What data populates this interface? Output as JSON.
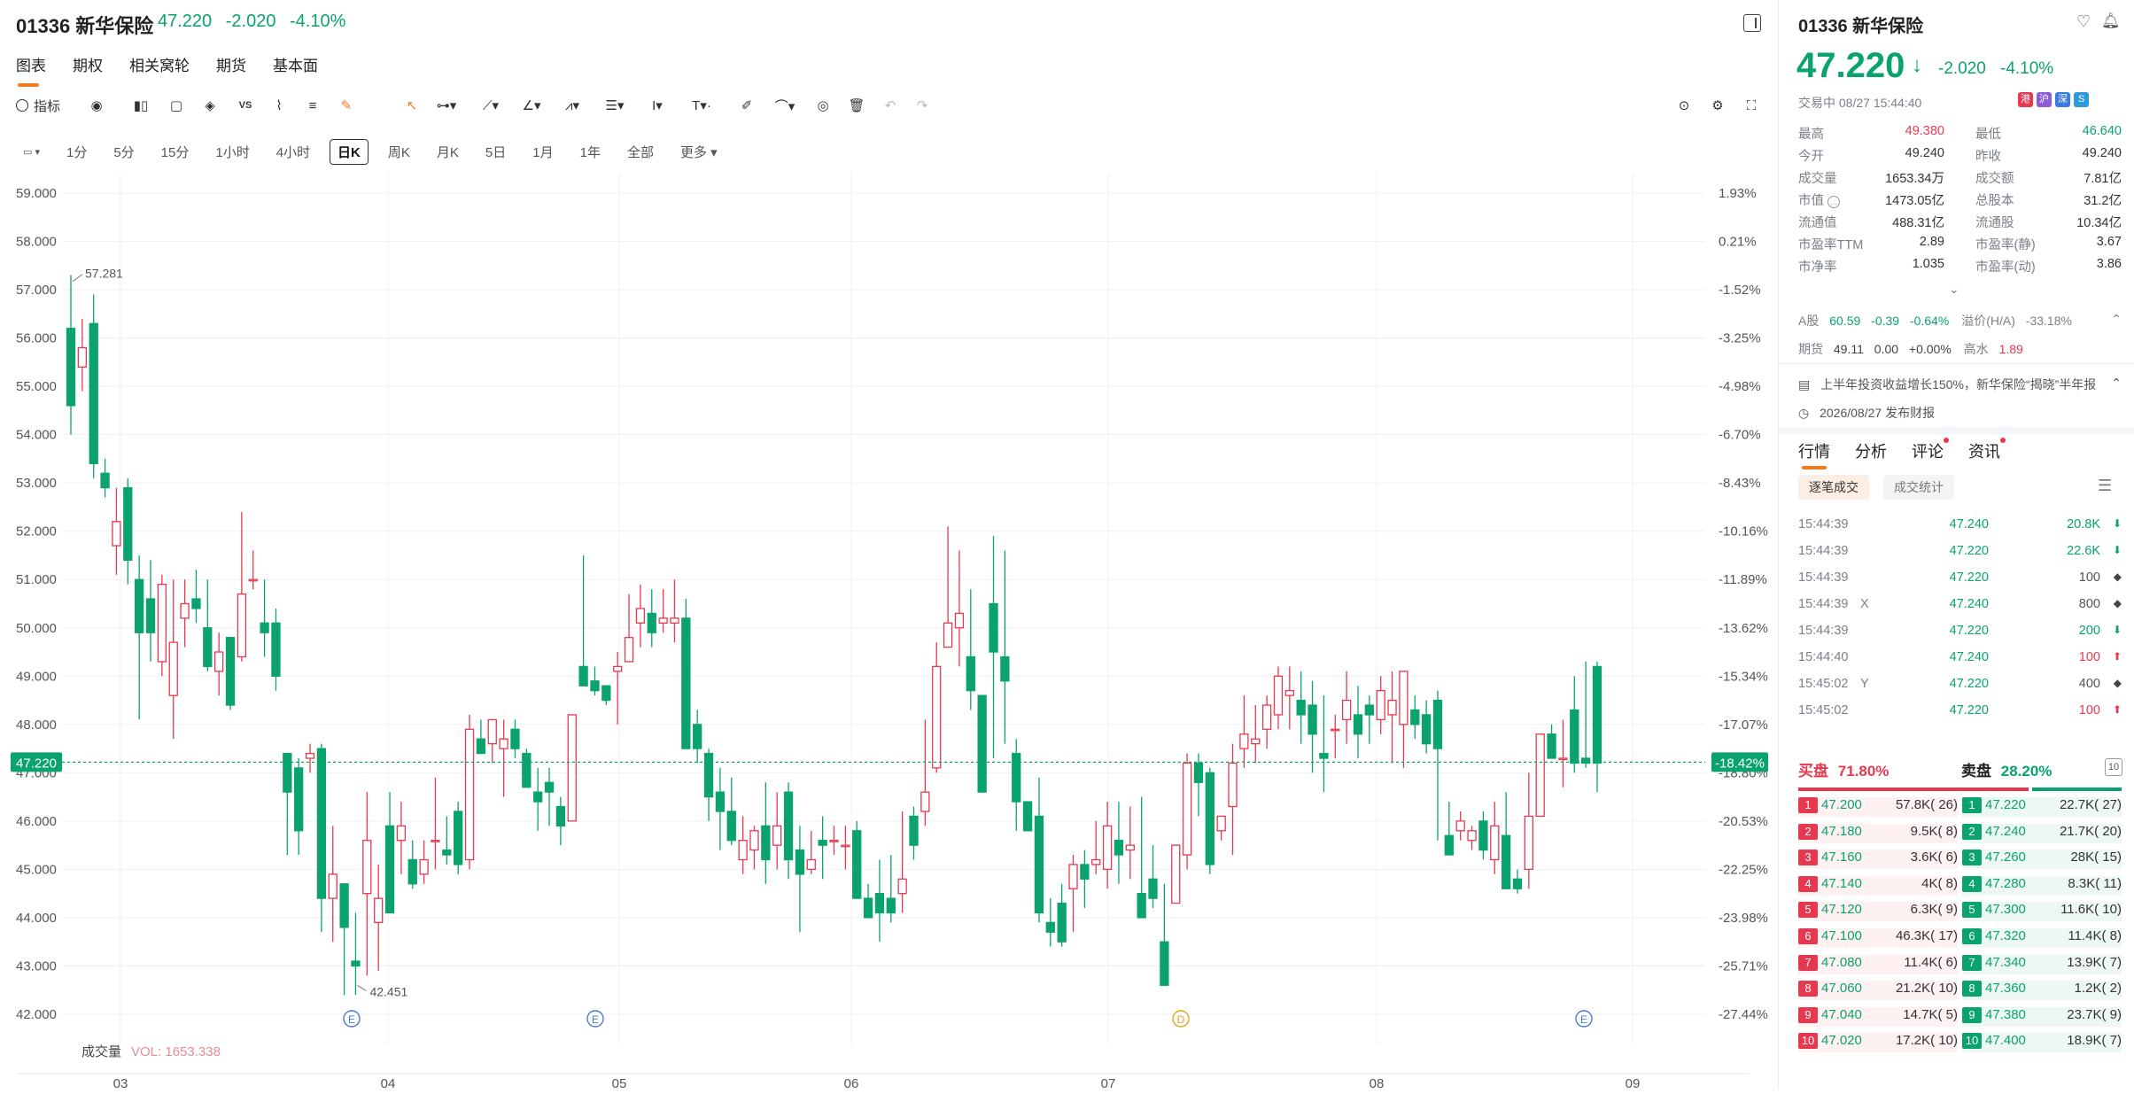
{
  "header": {
    "symbol": "01336 新华保险",
    "price": "47.220",
    "change": "-2.020",
    "change_pct": "-4.10%",
    "tabs": [
      "图表",
      "期权",
      "相关窝轮",
      "期货",
      "基本面"
    ],
    "active_tab": 0
  },
  "toolbar": {
    "indicator_label": "指标",
    "icons": [
      "indicator-icon",
      "replay-icon",
      "candle-type-icon",
      "square-icon",
      "layers-icon",
      "vs-icon",
      "chart-type-icon",
      "text-lines-icon",
      "pen-icon",
      "cursor-icon",
      "line-tool-icon",
      "trend-tool-icon",
      "angle-tool-icon",
      "pattern-tool-icon",
      "fib-tool-icon",
      "measure-tool-icon",
      "text-tool-icon",
      "brush-tool-icon",
      "eye-icon",
      "trash-icon",
      "undo-icon",
      "redo-icon"
    ],
    "right_icons": [
      "camera-icon",
      "settings-icon",
      "fullscreen-icon"
    ]
  },
  "periods": {
    "items": [
      "1分",
      "5分",
      "15分",
      "1小时",
      "4小时",
      "日K",
      "周K",
      "月K",
      "5日",
      "1月",
      "1年",
      "全部",
      "更多"
    ],
    "active": "日K"
  },
  "chart_data": {
    "type": "candlestick",
    "y_ticks": [
      "59.000",
      "58.000",
      "57.000",
      "56.000",
      "55.000",
      "54.000",
      "53.000",
      "52.000",
      "51.000",
      "50.000",
      "49.000",
      "48.000",
      "47.000",
      "46.000",
      "45.000",
      "44.000",
      "43.000",
      "42.000"
    ],
    "pct_ticks": [
      "1.93%",
      "0.21%",
      "-1.52%",
      "-3.25%",
      "-4.98%",
      "-6.70%",
      "-8.43%",
      "-10.16%",
      "-11.89%",
      "-13.62%",
      "-15.34%",
      "-17.07%",
      "-18.80%",
      "-20.53%",
      "-22.25%",
      "-23.98%",
      "-25.71%",
      "-27.44%"
    ],
    "x_labels": [
      "03",
      "04",
      "05",
      "06",
      "07",
      "08",
      "09"
    ],
    "ylim": [
      42.0,
      59.0
    ],
    "last_price": "47.220",
    "last_pct": "-18.42%",
    "high_label": "57.281",
    "low_label": "42.451",
    "event_markers": [
      "E",
      "E",
      "D",
      "E"
    ],
    "volume_label": "成交量",
    "volume_value": "VOL: 1653.338",
    "candles": [
      [
        56.2,
        57.3,
        54.0,
        54.6
      ],
      [
        55.4,
        56.4,
        54.9,
        55.8
      ],
      [
        56.3,
        56.9,
        53.1,
        53.4
      ],
      [
        53.2,
        53.5,
        52.7,
        52.9
      ],
      [
        51.7,
        52.9,
        51.1,
        52.2
      ],
      [
        52.9,
        53.1,
        50.9,
        51.4
      ],
      [
        51.0,
        51.5,
        48.1,
        49.9
      ],
      [
        50.6,
        51.4,
        49.3,
        49.9
      ],
      [
        49.3,
        51.1,
        49.0,
        50.9
      ],
      [
        48.6,
        51.0,
        47.7,
        49.7
      ],
      [
        50.2,
        51.0,
        49.6,
        50.5
      ],
      [
        50.6,
        51.2,
        50.1,
        50.4
      ],
      [
        50.0,
        51.0,
        49.1,
        49.2
      ],
      [
        49.1,
        49.9,
        48.6,
        49.5
      ],
      [
        49.8,
        49.4,
        48.3,
        48.4
      ],
      [
        49.4,
        52.4,
        49.3,
        50.7
      ],
      [
        51.0,
        51.6,
        50.8,
        51.0
      ],
      [
        50.1,
        51.0,
        49.4,
        49.9
      ],
      [
        50.1,
        50.4,
        48.7,
        49.0
      ],
      [
        47.4,
        47.4,
        45.3,
        46.6
      ],
      [
        47.1,
        47.3,
        45.3,
        45.8
      ],
      [
        47.3,
        47.6,
        47.0,
        47.4
      ],
      [
        47.5,
        47.6,
        43.7,
        44.4
      ],
      [
        44.4,
        45.9,
        43.5,
        44.9
      ],
      [
        44.7,
        44.6,
        42.4,
        43.8
      ],
      [
        43.1,
        44.1,
        42.4,
        43.0
      ],
      [
        44.5,
        46.6,
        42.8,
        45.6
      ],
      [
        43.9,
        45.1,
        42.9,
        44.4
      ],
      [
        45.9,
        46.6,
        44.5,
        44.1
      ],
      [
        45.6,
        46.4,
        44.9,
        45.9
      ],
      [
        45.2,
        45.6,
        44.6,
        44.7
      ],
      [
        44.9,
        45.6,
        44.7,
        45.2
      ],
      [
        45.6,
        46.9,
        45.0,
        45.6
      ],
      [
        45.4,
        46.1,
        45.1,
        45.3
      ],
      [
        46.2,
        46.4,
        44.9,
        45.1
      ],
      [
        45.2,
        48.2,
        45.0,
        47.9
      ],
      [
        47.7,
        48.1,
        47.6,
        47.4
      ],
      [
        47.6,
        48.1,
        47.2,
        48.1
      ],
      [
        47.5,
        48.1,
        46.5,
        47.7
      ],
      [
        47.9,
        48.1,
        47.3,
        47.5
      ],
      [
        47.4,
        47.5,
        46.7,
        46.7
      ],
      [
        46.6,
        47.1,
        45.8,
        46.4
      ],
      [
        46.8,
        47.1,
        45.9,
        46.6
      ],
      [
        46.3,
        46.5,
        45.5,
        45.9
      ],
      [
        46.0,
        48.1,
        46.0,
        48.2
      ],
      [
        49.2,
        51.5,
        49.0,
        48.8
      ],
      [
        48.9,
        49.2,
        48.6,
        48.7
      ],
      [
        48.8,
        48.6,
        48.4,
        48.5
      ],
      [
        49.1,
        49.5,
        48.0,
        49.2
      ],
      [
        49.3,
        50.7,
        49.3,
        49.8
      ],
      [
        50.1,
        50.9,
        49.6,
        50.4
      ],
      [
        50.3,
        50.8,
        49.6,
        49.9
      ],
      [
        50.1,
        50.8,
        49.9,
        50.2
      ],
      [
        50.1,
        51.0,
        49.7,
        50.2
      ],
      [
        50.2,
        50.6,
        47.8,
        47.5
      ],
      [
        48.0,
        48.3,
        47.2,
        47.5
      ],
      [
        47.4,
        47.5,
        46.0,
        46.5
      ],
      [
        46.6,
        47.1,
        45.4,
        46.2
      ],
      [
        46.2,
        46.9,
        45.5,
        45.6
      ],
      [
        45.2,
        46.1,
        44.9,
        45.6
      ],
      [
        45.4,
        45.9,
        45.0,
        45.8
      ],
      [
        45.9,
        46.8,
        44.7,
        45.2
      ],
      [
        45.5,
        46.6,
        45.0,
        45.9
      ],
      [
        46.6,
        46.8,
        44.8,
        45.2
      ],
      [
        45.4,
        45.9,
        43.7,
        44.9
      ],
      [
        45.0,
        45.8,
        44.9,
        45.2
      ],
      [
        45.6,
        46.1,
        44.8,
        45.5
      ],
      [
        45.6,
        45.9,
        45.3,
        45.6
      ],
      [
        45.5,
        45.9,
        45.0,
        45.5
      ],
      [
        45.8,
        46.0,
        44.4,
        44.4
      ],
      [
        44.4,
        44.7,
        44.1,
        44.0
      ],
      [
        44.5,
        45.2,
        43.5,
        44.1
      ],
      [
        44.4,
        45.3,
        43.9,
        44.1
      ],
      [
        44.5,
        46.2,
        44.1,
        44.8
      ],
      [
        46.1,
        46.3,
        45.2,
        45.5
      ],
      [
        46.2,
        48.1,
        45.9,
        46.6
      ],
      [
        47.1,
        49.7,
        47.0,
        49.2
      ],
      [
        49.6,
        52.1,
        49.6,
        50.1
      ],
      [
        50.0,
        51.6,
        49.2,
        50.3
      ],
      [
        49.4,
        50.8,
        48.3,
        48.7
      ],
      [
        48.6,
        48.5,
        46.7,
        46.6
      ],
      [
        50.5,
        51.9,
        47.3,
        49.5
      ],
      [
        49.4,
        51.6,
        47.6,
        48.9
      ],
      [
        47.4,
        47.7,
        45.8,
        46.4
      ],
      [
        46.4,
        46.4,
        45.8,
        45.8
      ],
      [
        46.1,
        46.9,
        43.9,
        44.1
      ],
      [
        43.9,
        44.4,
        43.4,
        43.7
      ],
      [
        44.3,
        44.7,
        43.4,
        43.5
      ],
      [
        44.6,
        45.3,
        43.7,
        45.1
      ],
      [
        45.1,
        45.4,
        44.2,
        44.8
      ],
      [
        45.1,
        46.0,
        44.9,
        45.2
      ],
      [
        45.0,
        46.4,
        44.6,
        45.9
      ],
      [
        45.6,
        46.4,
        44.7,
        45.3
      ],
      [
        45.4,
        46.3,
        44.8,
        45.5
      ],
      [
        44.5,
        46.5,
        44.2,
        44.0
      ],
      [
        44.8,
        45.5,
        44.2,
        44.4
      ],
      [
        43.5,
        44.7,
        42.9,
        42.6
      ],
      [
        44.3,
        45.5,
        44.3,
        45.5
      ],
      [
        45.3,
        47.4,
        45.0,
        47.2
      ],
      [
        47.2,
        47.4,
        46.1,
        46.8
      ],
      [
        47.0,
        47.1,
        44.9,
        45.1
      ],
      [
        45.8,
        46.1,
        45.6,
        46.1
      ],
      [
        46.3,
        47.6,
        45.3,
        47.2
      ],
      [
        47.5,
        48.6,
        47.1,
        47.8
      ],
      [
        47.6,
        48.4,
        47.2,
        47.7
      ],
      [
        47.9,
        48.6,
        47.5,
        48.4
      ],
      [
        48.2,
        49.2,
        47.9,
        49.0
      ],
      [
        48.6,
        49.2,
        47.9,
        48.7
      ],
      [
        48.5,
        49.1,
        47.6,
        48.2
      ],
      [
        48.4,
        48.9,
        47.0,
        47.8
      ],
      [
        47.4,
        48.6,
        46.6,
        47.3
      ],
      [
        47.9,
        48.2,
        47.3,
        47.9
      ],
      [
        48.1,
        49.1,
        47.6,
        48.5
      ],
      [
        48.2,
        48.8,
        47.3,
        47.8
      ],
      [
        48.4,
        48.6,
        47.6,
        48.2
      ],
      [
        48.1,
        49.0,
        47.8,
        48.7
      ],
      [
        48.2,
        49.1,
        47.2,
        48.5
      ],
      [
        48.0,
        49.0,
        47.1,
        49.1
      ],
      [
        48.3,
        48.6,
        47.7,
        48.0
      ],
      [
        48.2,
        48.5,
        47.4,
        47.6
      ],
      [
        48.5,
        48.7,
        45.6,
        47.5
      ],
      [
        45.7,
        46.4,
        45.6,
        45.3
      ],
      [
        45.8,
        46.2,
        45.6,
        46.0
      ],
      [
        45.6,
        45.9,
        45.4,
        45.8
      ],
      [
        46.0,
        46.2,
        45.2,
        45.4
      ],
      [
        45.2,
        46.4,
        44.9,
        45.9
      ],
      [
        45.7,
        46.6,
        44.6,
        44.6
      ],
      [
        44.8,
        45.0,
        44.5,
        44.6
      ],
      [
        45.0,
        47.0,
        44.6,
        46.1
      ],
      [
        46.1,
        47.8,
        46.1,
        47.8
      ],
      [
        47.8,
        48.0,
        47.5,
        47.3
      ],
      [
        47.3,
        48.1,
        46.7,
        47.3
      ],
      [
        48.3,
        49.0,
        47.0,
        47.2
      ],
      [
        47.3,
        49.3,
        47.1,
        47.2
      ],
      [
        49.2,
        49.3,
        46.6,
        47.2
      ]
    ]
  },
  "panel": {
    "symbol": "01336 新华保险",
    "price": "47.220",
    "change": "-2.020",
    "change_pct": "-4.10%",
    "status": "交易中 08/27 15:44:40",
    "badges": [
      "港",
      "沪",
      "深",
      "S"
    ],
    "stats": [
      {
        "label": "最高",
        "value": "49.380",
        "label2": "最低",
        "value2": "46.640"
      },
      {
        "label": "今开",
        "value": "49.240",
        "label2": "昨收",
        "value2": "49.240"
      },
      {
        "label": "成交量",
        "value": "1653.34万",
        "label2": "成交额",
        "value2": "7.81亿"
      },
      {
        "label": "市值",
        "value": "1473.05亿",
        "label2": "总股本",
        "value2": "31.2亿"
      },
      {
        "label": "流通值",
        "value": "488.31亿",
        "label2": "流通股",
        "value2": "10.34亿"
      },
      {
        "label": "市盈率TTM",
        "value": "2.89",
        "label2": "市盈率(静)",
        "value2": "3.67"
      },
      {
        "label": "市净率",
        "value": "1.035",
        "label2": "市盈率(动)",
        "value2": "3.86"
      }
    ],
    "a_share": {
      "label": "A股",
      "price": "60.59",
      "change": "-0.39",
      "pct": "-0.64%",
      "premium_label": "溢价(H/A)",
      "premium": "-33.18%"
    },
    "futures": {
      "label": "期货",
      "price": "49.11",
      "change": "0.00",
      "pct": "+0.00%",
      "discount_label": "高水",
      "discount": "1.89"
    },
    "news": "上半年投资收益增长150%，新华保险“揭晓”半年报",
    "report": "2026/08/27 发布财报",
    "tabs": [
      "行情",
      "分析",
      "评论",
      "资讯"
    ],
    "subtabs": [
      "逐笔成交",
      "成交统计"
    ],
    "trades": [
      {
        "time": "15:44:39",
        "flag": "",
        "price": "47.240",
        "vol": "20.8K",
        "dir": "down"
      },
      {
        "time": "15:44:39",
        "flag": "",
        "price": "47.220",
        "vol": "22.6K",
        "dir": "down"
      },
      {
        "time": "15:44:39",
        "flag": "",
        "price": "47.220",
        "vol": "100",
        "dir": "neutral"
      },
      {
        "time": "15:44:39",
        "flag": "X",
        "price": "47.240",
        "vol": "800",
        "dir": "neutral"
      },
      {
        "time": "15:44:39",
        "flag": "",
        "price": "47.220",
        "vol": "200",
        "dir": "down"
      },
      {
        "time": "15:44:40",
        "flag": "",
        "price": "47.240",
        "vol": "100",
        "dir": "up"
      },
      {
        "time": "15:45:02",
        "flag": "Y",
        "price": "47.220",
        "vol": "400",
        "dir": "neutral"
      },
      {
        "time": "15:45:02",
        "flag": "",
        "price": "47.220",
        "vol": "100",
        "dir": "up"
      }
    ],
    "buy_label": "买盘",
    "buy_pct": "71.80%",
    "sell_label": "卖盘",
    "sell_pct": "28.20%",
    "depth_toggle": "10",
    "buy_ratio": 0.718,
    "bids": [
      {
        "n": "1",
        "price": "47.200",
        "vol": "57.8K",
        "orders": "26"
      },
      {
        "n": "2",
        "price": "47.180",
        "vol": "9.5K",
        "orders": "8"
      },
      {
        "n": "3",
        "price": "47.160",
        "vol": "3.6K",
        "orders": "6"
      },
      {
        "n": "4",
        "price": "47.140",
        "vol": "4K",
        "orders": "8"
      },
      {
        "n": "5",
        "price": "47.120",
        "vol": "6.3K",
        "orders": "9"
      },
      {
        "n": "6",
        "price": "47.100",
        "vol": "46.3K",
        "orders": "17"
      },
      {
        "n": "7",
        "price": "47.080",
        "vol": "11.4K",
        "orders": "6"
      },
      {
        "n": "8",
        "price": "47.060",
        "vol": "21.2K",
        "orders": "10"
      },
      {
        "n": "9",
        "price": "47.040",
        "vol": "14.7K",
        "orders": "5"
      },
      {
        "n": "10",
        "price": "47.020",
        "vol": "17.2K",
        "orders": "10"
      }
    ],
    "asks": [
      {
        "n": "1",
        "price": "47.220",
        "vol": "22.7K",
        "orders": "27"
      },
      {
        "n": "2",
        "price": "47.240",
        "vol": "21.7K",
        "orders": "20"
      },
      {
        "n": "3",
        "price": "47.260",
        "vol": "28K",
        "orders": "15"
      },
      {
        "n": "4",
        "price": "47.280",
        "vol": "8.3K",
        "orders": "11"
      },
      {
        "n": "5",
        "price": "47.300",
        "vol": "11.6K",
        "orders": "10"
      },
      {
        "n": "6",
        "price": "47.320",
        "vol": "11.4K",
        "orders": "8"
      },
      {
        "n": "7",
        "price": "47.340",
        "vol": "13.9K",
        "orders": "7"
      },
      {
        "n": "8",
        "price": "47.360",
        "vol": "1.2K",
        "orders": "2"
      },
      {
        "n": "9",
        "price": "47.380",
        "vol": "23.7K",
        "orders": "9"
      },
      {
        "n": "10",
        "price": "47.400",
        "vol": "18.9K",
        "orders": "7"
      }
    ]
  },
  "colors": {
    "up": "#e6394f",
    "down": "#0aa36e",
    "accent": "#f17a1d"
  }
}
